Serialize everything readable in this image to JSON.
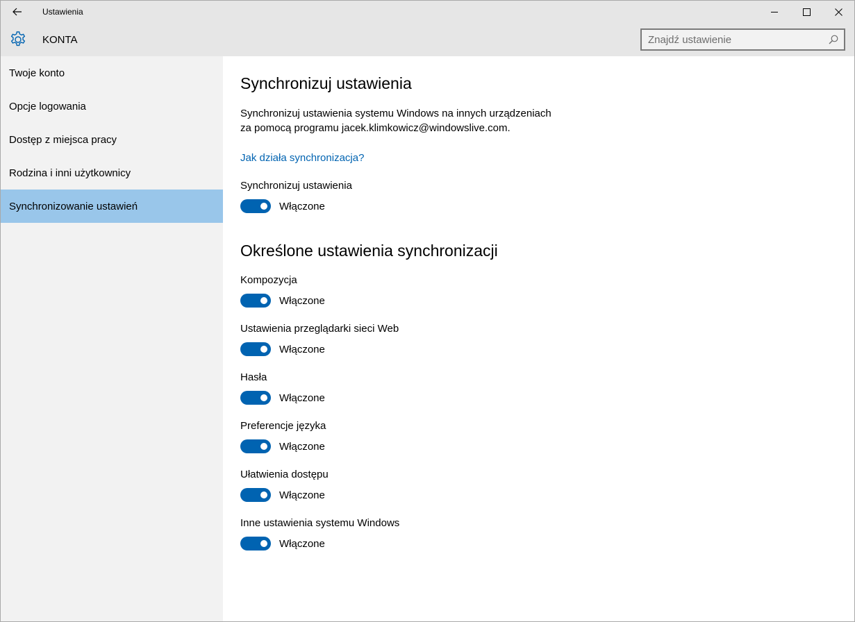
{
  "window": {
    "title": "Ustawienia",
    "controls": {
      "minimize": "minimize-icon",
      "maximize": "maximize-icon",
      "close": "close-icon"
    }
  },
  "header": {
    "title": "KONTA",
    "search_placeholder": "Znajdź ustawienie"
  },
  "sidebar": {
    "items": [
      {
        "label": "Twoje konto"
      },
      {
        "label": "Opcje logowania"
      },
      {
        "label": "Dostęp z miejsca pracy"
      },
      {
        "label": "Rodzina i inni użytkownicy"
      },
      {
        "label": "Synchronizowanie ustawień",
        "active": true
      }
    ]
  },
  "main": {
    "section1_title": "Synchronizuj ustawienia",
    "description_line1": "Synchronizuj ustawienia systemu Windows na innych urządzeniach",
    "description_line2": "za pomocą programu jacek.klimkowicz@windowslive.com.",
    "help_link": "Jak działa synchronizacja?",
    "master_toggle": {
      "label": "Synchronizuj ustawienia",
      "state": "Włączone"
    },
    "section2_title": "Określone ustawienia synchronizacji",
    "toggles": [
      {
        "label": "Kompozycja",
        "state": "Włączone"
      },
      {
        "label": "Ustawienia przeglądarki sieci Web",
        "state": "Włączone"
      },
      {
        "label": "Hasła",
        "state": "Włączone"
      },
      {
        "label": "Preferencje języka",
        "state": "Włączone"
      },
      {
        "label": "Ułatwienia dostępu",
        "state": "Włączone"
      },
      {
        "label": "Inne ustawienia systemu Windows",
        "state": "Włączone"
      }
    ]
  },
  "colors": {
    "accent": "#0063b1",
    "sidebar_selected": "#99c6ea",
    "chrome": "#e6e6e6",
    "sidebar_bg": "#f2f2f2"
  }
}
